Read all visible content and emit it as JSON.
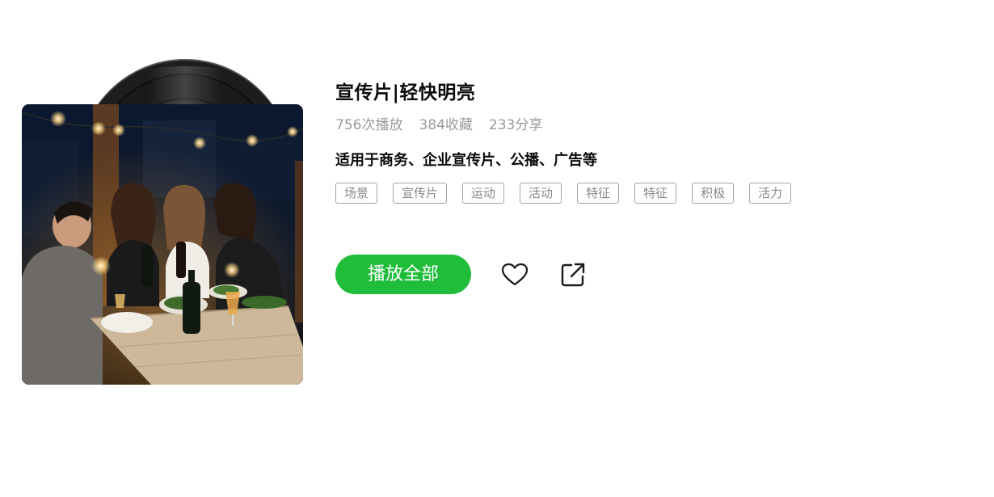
{
  "playlist": {
    "title": "宣传片|轻快明亮",
    "stats": {
      "plays": "756次播放",
      "favorites": "384收藏",
      "shares": "233分享"
    },
    "description": "适用于商务、企业宣传片、公播、广告等",
    "tags": [
      "场景",
      "宣传片",
      "运动",
      "活动",
      "特征",
      "特征",
      "积极",
      "活力"
    ],
    "cover_icon": "vinyl-record",
    "cover_image": "photo of friends dining at outdoor table at night with string lights"
  },
  "actions": {
    "play_all_label": "播放全部",
    "like_icon": "heart-icon",
    "share_icon": "share-icon",
    "accent_color": "#1fbd3a"
  }
}
